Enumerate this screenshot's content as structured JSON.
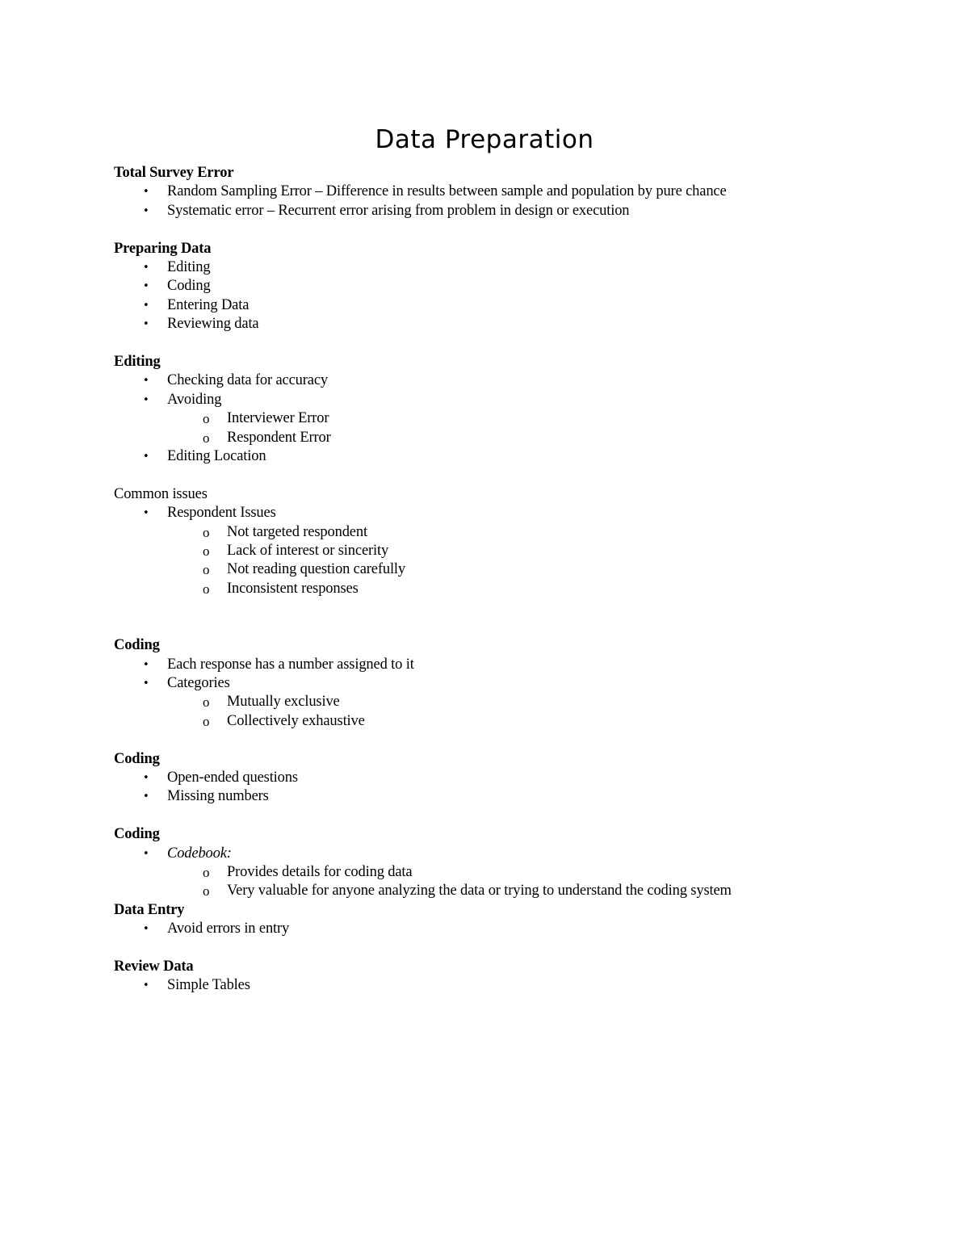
{
  "document": {
    "title": "Data Preparation",
    "bullet_glyph": "•",
    "sub_bullet_glyph": "o",
    "sections": [
      {
        "heading": "Total Survey Error",
        "heading_style": "bold",
        "items": [
          {
            "level": 1,
            "text": "Random Sampling Error –  Difference in results between sample and population by pure chance"
          },
          {
            "level": 1,
            "text": "Systematic error – Recurrent error arising from problem in design or execution"
          }
        ]
      },
      {
        "heading": "Preparing Data",
        "heading_style": "bold",
        "items": [
          {
            "level": 1,
            "text": "Editing"
          },
          {
            "level": 1,
            "text": "Coding"
          },
          {
            "level": 1,
            "text": "Entering Data"
          },
          {
            "level": 1,
            "text": "Reviewing data"
          }
        ]
      },
      {
        "heading": "Editing",
        "heading_style": "bold",
        "items": [
          {
            "level": 1,
            "text": "Checking data for accuracy"
          },
          {
            "level": 1,
            "text": "Avoiding"
          },
          {
            "level": 2,
            "text": "Interviewer Error"
          },
          {
            "level": 2,
            "text": "Respondent Error"
          },
          {
            "level": 1,
            "text": "Editing Location"
          }
        ]
      },
      {
        "heading": "Common issues",
        "heading_style": "plain",
        "items": [
          {
            "level": 1,
            "text": "Respondent Issues"
          },
          {
            "level": 2,
            "text": "Not targeted respondent"
          },
          {
            "level": 2,
            "text": "Lack of interest or sincerity"
          },
          {
            "level": 2,
            "text": "Not reading question carefully"
          },
          {
            "level": 2,
            "text": "Inconsistent responses"
          }
        ],
        "gap_after": "large"
      },
      {
        "heading": "Coding",
        "heading_style": "bold",
        "items": [
          {
            "level": 1,
            "text": "Each response has a number assigned to it"
          },
          {
            "level": 1,
            "text": "Categories"
          },
          {
            "level": 2,
            "text": "Mutually exclusive"
          },
          {
            "level": 2,
            "text": "Collectively exhaustive"
          }
        ]
      },
      {
        "heading": "Coding",
        "heading_style": "bold",
        "items": [
          {
            "level": 1,
            "text": "Open-ended questions"
          },
          {
            "level": 1,
            "text": "Missing numbers"
          }
        ]
      },
      {
        "heading": "Coding",
        "heading_style": "bold",
        "items": [
          {
            "level": 1,
            "text": "Codebook:",
            "italic": true
          },
          {
            "level": 2,
            "text": "Provides details for coding data"
          },
          {
            "level": 2,
            "text": "Very valuable for anyone analyzing the data or trying to understand the coding system"
          }
        ],
        "gap_after": "none"
      },
      {
        "heading": "Data Entry",
        "heading_style": "bold",
        "items": [
          {
            "level": 1,
            "text": "Avoid errors in entry"
          }
        ]
      },
      {
        "heading": "Review Data",
        "heading_style": "bold",
        "items": [
          {
            "level": 1,
            "text": "Simple Tables"
          }
        ],
        "gap_after": "none"
      }
    ]
  }
}
